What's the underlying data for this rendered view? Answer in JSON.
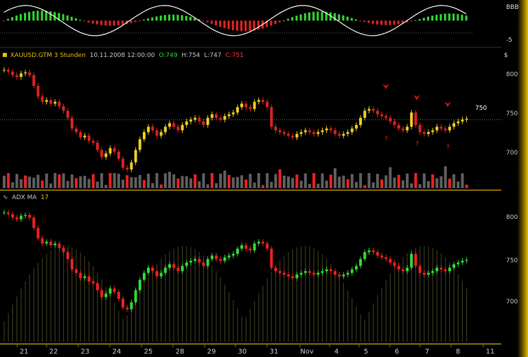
{
  "osc_panel": {
    "label_top": "BBB",
    "label_bottom": "-5"
  },
  "price_panel": {
    "symbol": "XAUUSD.GTM 3 Stunden",
    "datetime": "10.11.2008 12:00:00",
    "open": "O:749",
    "high": "H:754",
    "low": "L:747",
    "close": "C:751",
    "axis_unit": "$",
    "current_price": "750",
    "y_ticks": [
      "800",
      "750",
      "700"
    ],
    "markers": [
      "?",
      "?",
      "?"
    ]
  },
  "adx_panel": {
    "title": "ADX MA",
    "period": "17",
    "y_ticks": [
      "800",
      "750",
      "700"
    ]
  },
  "x_axis": {
    "labels": [
      "21",
      "22",
      "23",
      "24",
      "25",
      "28",
      "29",
      "30",
      "31",
      "Nov",
      "4",
      "5",
      "6",
      "7",
      "8",
      "11"
    ]
  },
  "colors": {
    "up": "#33dd33",
    "down": "#ee2222",
    "candle_up": "#f0d020",
    "candle_down": "#dd2222",
    "volume": "#606060",
    "gold": "#e8c000"
  },
  "chart_data": {
    "type": "candlestick",
    "price_range": [
      680,
      815
    ],
    "close_series": [
      806,
      804,
      800,
      798,
      802,
      803,
      800,
      788,
      776,
      770,
      772,
      768,
      770,
      765,
      760,
      752,
      740,
      736,
      730,
      732,
      726,
      724,
      716,
      708,
      712,
      718,
      714,
      706,
      696,
      694,
      702,
      716,
      728,
      736,
      742,
      738,
      732,
      736,
      742,
      746,
      742,
      738,
      744,
      748,
      750,
      752,
      748,
      744,
      752,
      756,
      752,
      750,
      754,
      756,
      758,
      764,
      768,
      764,
      762,
      770,
      772,
      770,
      764,
      742,
      738,
      736,
      734,
      732,
      730,
      734,
      736,
      738,
      736,
      734,
      736,
      738,
      740,
      738,
      734,
      732,
      734,
      736,
      740,
      744,
      752,
      760,
      762,
      760,
      756,
      754,
      752,
      748,
      744,
      740,
      738,
      742,
      758,
      744,
      736,
      734,
      736,
      738,
      742,
      740,
      738,
      742,
      746,
      748,
      750,
      751
    ]
  }
}
